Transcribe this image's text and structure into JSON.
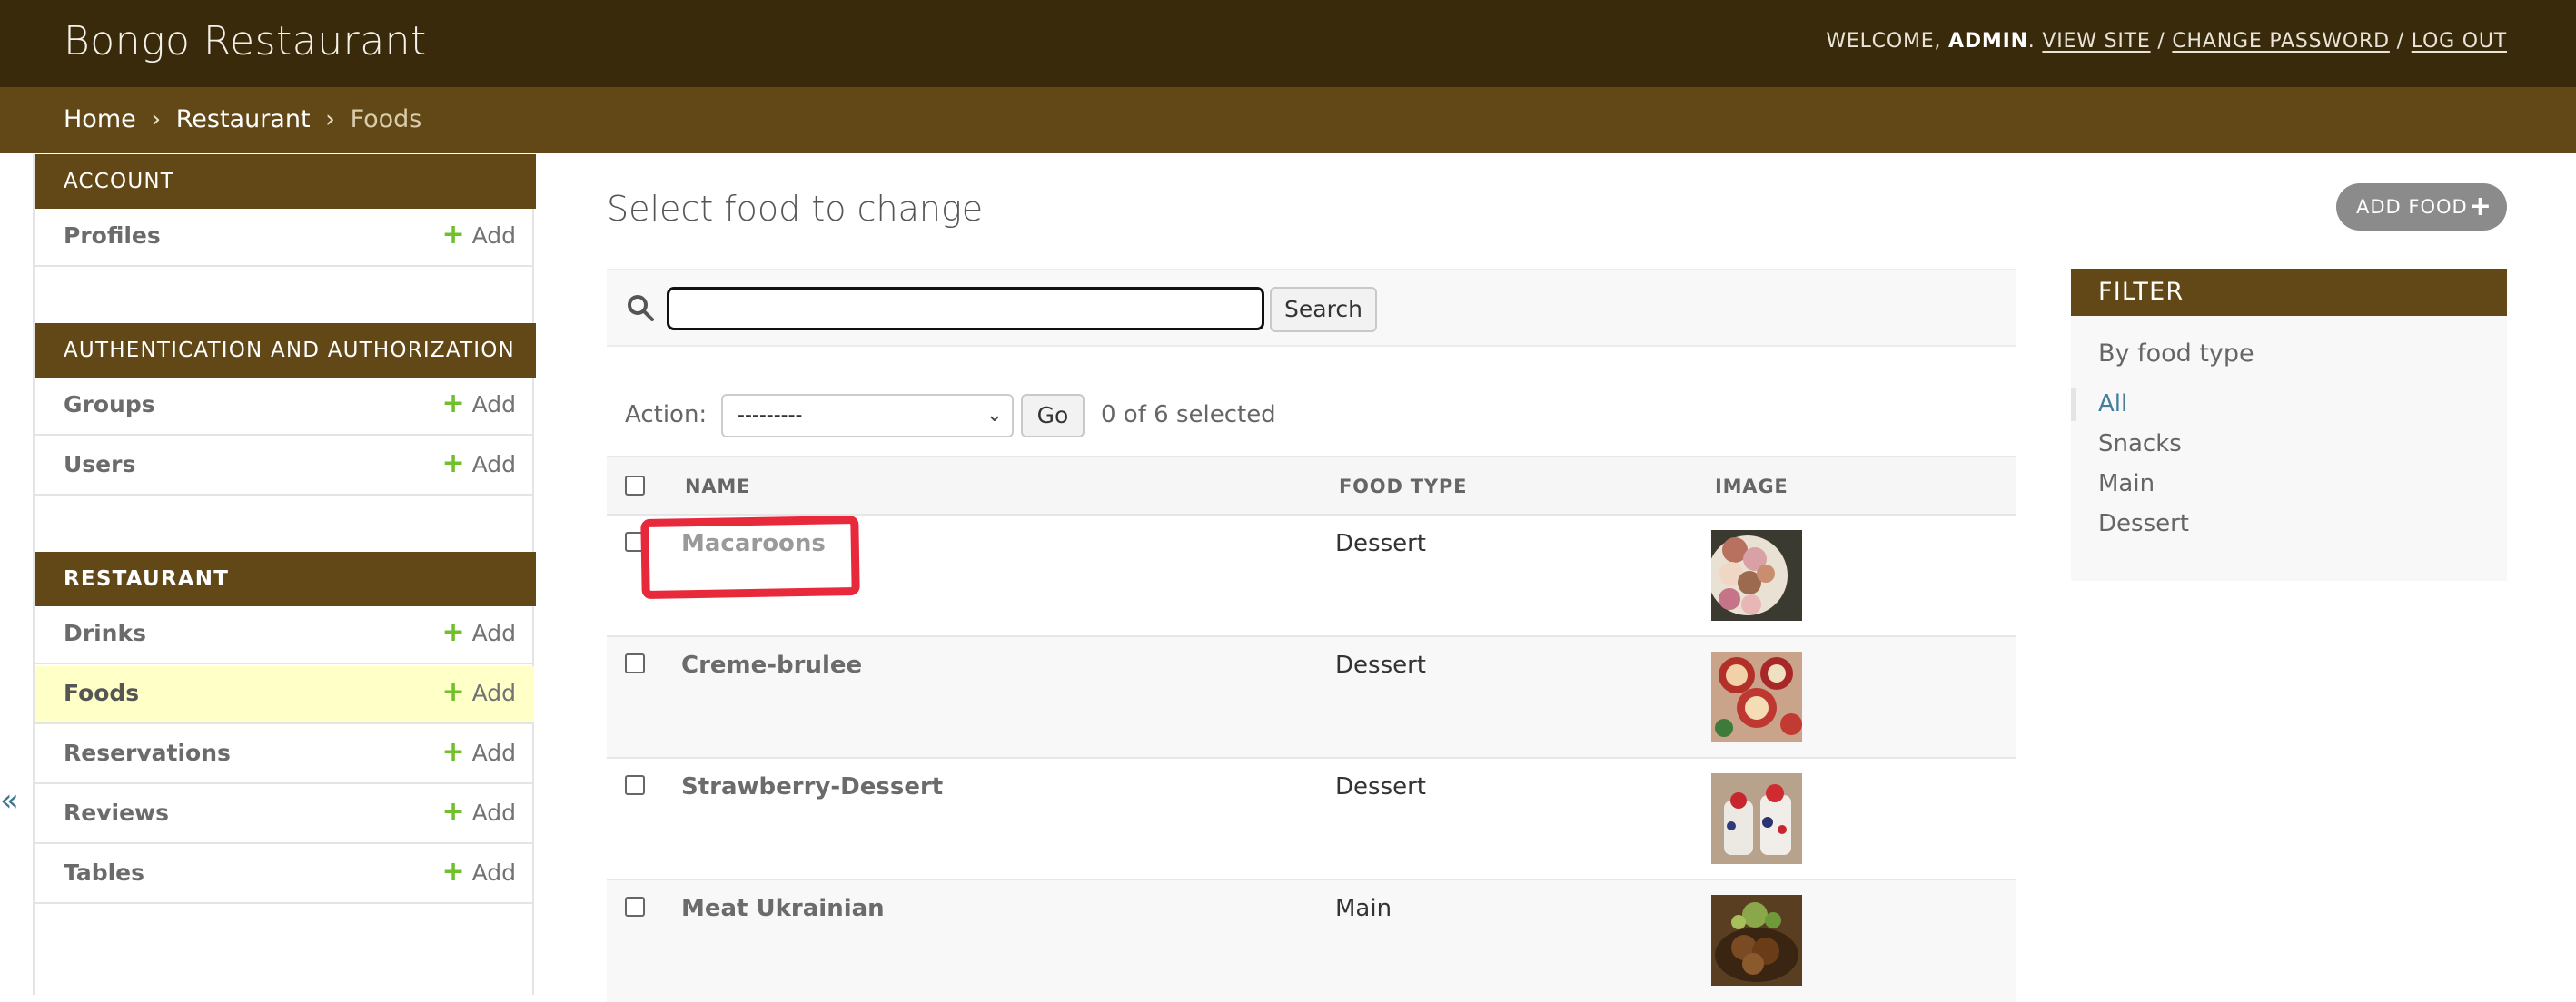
{
  "header": {
    "title": "Bongo Restaurant",
    "welcome": "WELCOME, ",
    "username": "ADMIN",
    "period": ".",
    "sep": " / ",
    "view_site": "VIEW SITE",
    "change_password": "CHANGE PASSWORD",
    "log_out": "LOG OUT"
  },
  "breadcrumbs": {
    "home": "Home",
    "sep": "›",
    "app": "Restaurant",
    "current": "Foods"
  },
  "sidebar": {
    "add_label": "Add",
    "toggle": "«",
    "modules": [
      {
        "caption": "ACCOUNT",
        "items": [
          {
            "label": "Profiles"
          }
        ]
      },
      {
        "caption": "AUTHENTICATION AND AUTHORIZATION",
        "items": [
          {
            "label": "Groups"
          },
          {
            "label": "Users"
          }
        ]
      },
      {
        "caption": "RESTAURANT",
        "items": [
          {
            "label": "Drinks"
          },
          {
            "label": "Foods"
          },
          {
            "label": "Reservations"
          },
          {
            "label": "Reviews"
          },
          {
            "label": "Tables"
          }
        ]
      }
    ]
  },
  "content": {
    "title": "Select food to change",
    "add_button": "ADD FOOD",
    "search": {
      "value": "",
      "button": "Search"
    },
    "actions": {
      "label": "Action:",
      "selected": "---------",
      "go": "Go",
      "counter": "0 of 6 selected"
    },
    "table": {
      "headers": {
        "name": "NAME",
        "type": "FOOD TYPE",
        "image": "IMAGE"
      },
      "rows": [
        {
          "name": "Macaroons",
          "type": "Dessert",
          "thumb": "macaroons-image"
        },
        {
          "name": "Creme-brulee",
          "type": "Dessert",
          "thumb": "creme-brulee-image"
        },
        {
          "name": "Strawberry-Dessert",
          "type": "Dessert",
          "thumb": "strawberry-dessert-image"
        },
        {
          "name": "Meat Ukrainian",
          "type": "Main",
          "thumb": "meat-ukrainian-image"
        }
      ]
    }
  },
  "filter": {
    "title": "FILTER",
    "subtitle": "By food type",
    "options": [
      "All",
      "Snacks",
      "Main",
      "Dessert"
    ],
    "selected": "All"
  },
  "colors": {
    "header_bg": "#3a2a0c",
    "module_bg": "#624816",
    "current_row_bg": "#ffffc8",
    "add_plus": "#70bf2b",
    "link_blue": "#447e9b",
    "highlight_red": "#e8293c"
  }
}
